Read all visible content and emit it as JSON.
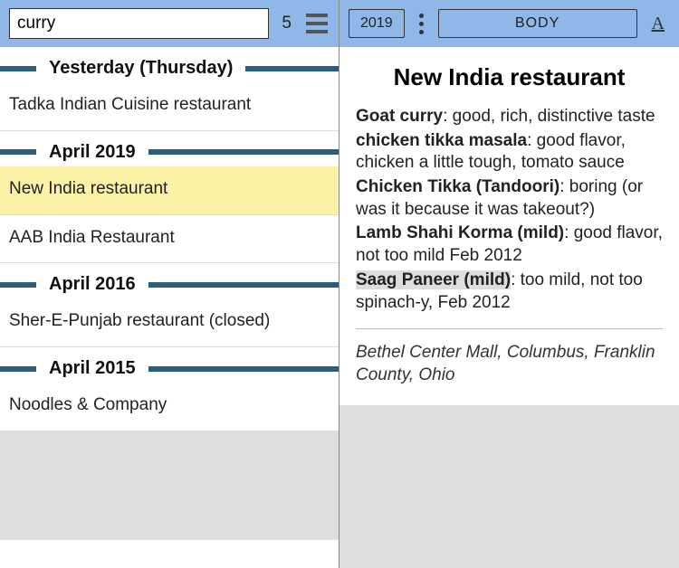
{
  "left": {
    "search_value": "curry",
    "result_count": "5",
    "sections": [
      {
        "label": "Yesterday (Thursday)",
        "items": [
          "Tadka Indian Cuisine restaurant"
        ]
      },
      {
        "label": "April 2019",
        "items": [
          "New India restaurant",
          "AAB India Restaurant"
        ]
      },
      {
        "label": "April 2016",
        "items": [
          "Sher-E-Punjab restaurant (closed)"
        ]
      },
      {
        "label": "April 2015",
        "items": [
          "Noodles & Company"
        ]
      }
    ],
    "selected": "New India restaurant"
  },
  "right": {
    "year_button": "2019",
    "mode_button": "BODY",
    "font_button": "A",
    "title": "New India restaurant",
    "dishes": [
      {
        "name": "Goat curry",
        "desc": ": good, rich, distinctive taste"
      },
      {
        "name": "chicken tikka masala",
        "desc": ": good flavor, chicken a little tough, tomato sauce"
      },
      {
        "name": "Chicken Tikka (Tandoori)",
        "desc": ": boring (or was it because it was takeout?)"
      },
      {
        "name": "Lamb Shahi Korma (mild)",
        "desc": ": good flavor, not too mild Feb 2012"
      },
      {
        "name": "Saag Paneer (mild)",
        "desc": ": too mild, not too spinach-y, Feb 2012",
        "highlight": true
      }
    ],
    "location": "Bethel Center Mall, Columbus, Franklin County, Ohio"
  }
}
